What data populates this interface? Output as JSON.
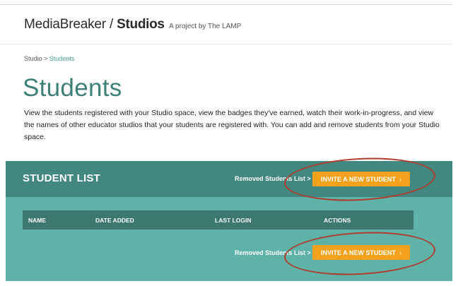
{
  "brand": {
    "name": "MediaBreaker / ",
    "name_bold": "Studios",
    "tagline": "A project by The LAMP"
  },
  "breadcrumb": {
    "root": "Studio",
    "separator": " > ",
    "current": "Students"
  },
  "page": {
    "title": "Students",
    "description": "View the students registered with your Studio space, view the badges they've earned, watch their work-in-progress, and view the names of other educator studios that your students are registered with. You can add and remove students from your Studio space."
  },
  "student_list": {
    "title": "STUDENT LIST",
    "removed_link": "Removed Students List >",
    "invite_button": "INVITE A NEW STUDENT",
    "invite_chevron": "›",
    "columns": [
      "NAME",
      "DATE ADDED",
      "LAST LOGIN",
      "ACTIONS"
    ]
  },
  "colors": {
    "brand_teal": "#3e8078",
    "panel_header": "#428880",
    "panel_body": "#5fb2a8",
    "table_header": "#3c7770",
    "invite_button": "#f4a21e",
    "annotation_ring": "#b03b2c"
  }
}
